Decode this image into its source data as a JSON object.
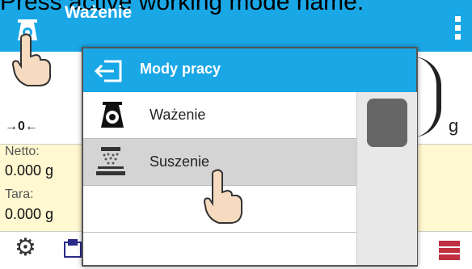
{
  "caption": "Press active working mode name.",
  "app": {
    "title": "Ważenie"
  },
  "display": {
    "zero_indicator": "→0←",
    "unit": "g"
  },
  "readouts": {
    "netto_label": "Netto:",
    "netto_value": "0.000 g",
    "tara_label": "Tara:",
    "tara_value": "0.000 g"
  },
  "dialog": {
    "title": "Mody pracy",
    "items": [
      {
        "label": "Ważenie",
        "icon": "weighing-mode-icon",
        "selected": false
      },
      {
        "label": "Suszenie",
        "icon": "drying-mode-icon",
        "selected": true
      }
    ]
  },
  "colors": {
    "accent": "#1aa7e6",
    "selected_row": "#d4d4d4",
    "netto_bg": "#fff8d0"
  }
}
